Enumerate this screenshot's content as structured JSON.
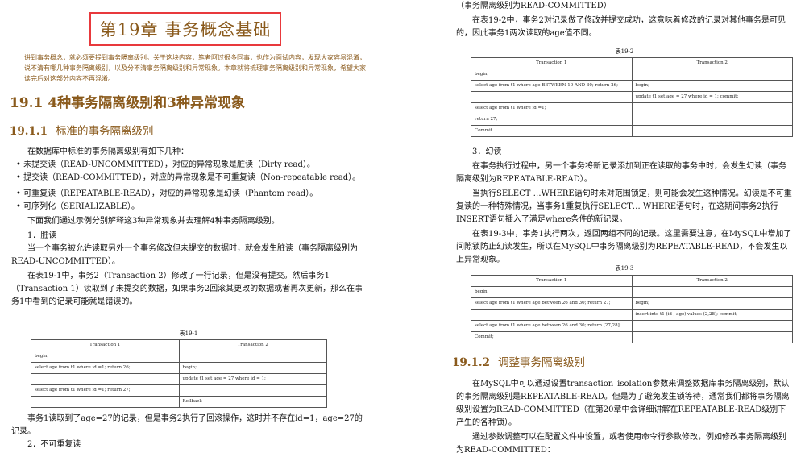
{
  "chapter_title": "第19章   事务概念基础",
  "intro": "讲到事务概念，就必须要提到事务隔离级别。关于这块内容，笔者阿过很多同事，也作为面试内容，发现大家容易混淆，说不清有哪几种事务隔离级别，以及分不清事务隔离级别和异常现象。本章就将梳理事务隔离级别和异常现象，希望大家读完后对这部分内容不再混淆。",
  "section_19_1": "19.1   4种事务隔离级别和3种异常现象",
  "section_19_1_1": {
    "num": "19.1.1",
    "title": "标准的事务隔离级别"
  },
  "left_body": {
    "p1": "在数据库中标准的事务隔离级别有如下几种：",
    "b1": "未提交读（READ-UNCOMMITTED），对应的异常现象是脏读（Dirty read）。",
    "b2": "提交读（READ-COMMITTED），对应的异常现象是不可重复读（Non-repeatable read）。",
    "b3": "可重复读（REPEATABLE-READ），对应的异常现象是幻读（Phantom read）。",
    "b4": "可序列化（SERIALIZABLE）。",
    "p2": "下面我们通过示例分别解释这3种异常现象并去理解4种事务隔离级别。",
    "h1": "1．脏读",
    "p3": "当一个事务被允许读取另外一个事务修改但未提交的数据时，就会发生脏读（事务隔离级别为READ-UNCOMMITTED）。",
    "p4": "在表19-1中，事务2（Transaction    2）修改了一行记录，但是没有提交。然后事务1（Transaction  1）读取到了未提交的数据，如果事务2回滚其更改的数据或者再次更新，那么在事务1中看到的记录可能就是错误的。",
    "p5": "事务1读取到了age=27的记录，但是事务2执行了回滚操作，这时并不存在id=1，age=27的记录。",
    "h2": "2．不可重复读"
  },
  "table_19_1": {
    "caption": "表19-1",
    "headers": [
      "Transaction 1",
      "Transaction 2"
    ],
    "rows": [
      [
        "begin;",
        ""
      ],
      [
        "select age from t1 where id =1;   return 26;",
        "begin;"
      ],
      [
        "",
        "update t1 set age = 27 where id = 1;"
      ],
      [
        "select age from t1 where id =1;    return 27;",
        ""
      ],
      [
        "",
        "Rollback"
      ]
    ]
  },
  "right_body": {
    "top": "（事务隔离级别为READ-COMMITTED）",
    "p1": "在表19-2中，事务2对记录做了修改并提交成功，这意味着修改的记录对其他事务是可见的，因此事务1两次读取的age值不同。",
    "h3": "3．幻读",
    "p2": "在事务执行过程中，另一个事务将新记录添加到正在读取的事务中时，会发生幻读（事务隔离级别为REPEATABLE-READ）。",
    "p3": "当执行SELECT  …WHERE语句时未对范围锁定，则可能会发生这种情况。幻读是不可重复读的一种特殊情况，当事务1重复执行SELECT… WHERE语句时，在这期间事务2执行INSERT语句插入了满足where条件的新记录。",
    "p4": "在表19-3中，事务1执行两次，返回两组不同的记录。这里需要注意，在MySQL中增加了间隙锁防止幻读发生，所以在MySQL中事务隔离级别为REPEATABLE-READ，不会发生以上异常现象。",
    "p5": "在MySQL中可以通过设置transaction_isolation参数来调整数据库事务隔离级别，默认的事务隔离级别是REPEATABLE-READ。但是为了避免发生锁等待，通常我们都将事务隔离级别设置为READ-COMMITTED（在第20章中会详细讲解在REPEATABLE-READ级别下产生的各种锁）。",
    "p6": "通过参数调整可以在配置文件中设置，或者使用命令行参数修改，例如修改事务隔离级别为READ-COMMITTED："
  },
  "table_19_2": {
    "caption": "表19-2",
    "headers": [
      "Transaction 1",
      "Transaction 2"
    ],
    "rows": [
      [
        "begin;",
        ""
      ],
      [
        "select age from t1 where age BETWEEN 10 AND 30;   return 26;",
        "begin;"
      ],
      [
        "",
        "update t1 set age = 27 where id = 1;    commit;"
      ],
      [
        "select age from t1 where id =1;",
        ""
      ],
      [
        "return 27;",
        ""
      ],
      [
        "Commit",
        ""
      ]
    ]
  },
  "table_19_3": {
    "caption": "表19-3",
    "headers": [
      "Transaction 1",
      "Transaction 2"
    ],
    "rows": [
      [
        "begin;",
        ""
      ],
      [
        "select age from t1 where age between 26 and 30;    return 27;",
        "begin;"
      ],
      [
        "",
        "insert into t1 (id , age) values (2,28);       commit;"
      ],
      [
        "select age from t1 where age between 26 and 30;    return [27,28];",
        ""
      ],
      [
        "Commit;",
        ""
      ]
    ]
  },
  "section_19_1_2": {
    "num": "19.1.2",
    "title": "调整事务隔离级别"
  }
}
